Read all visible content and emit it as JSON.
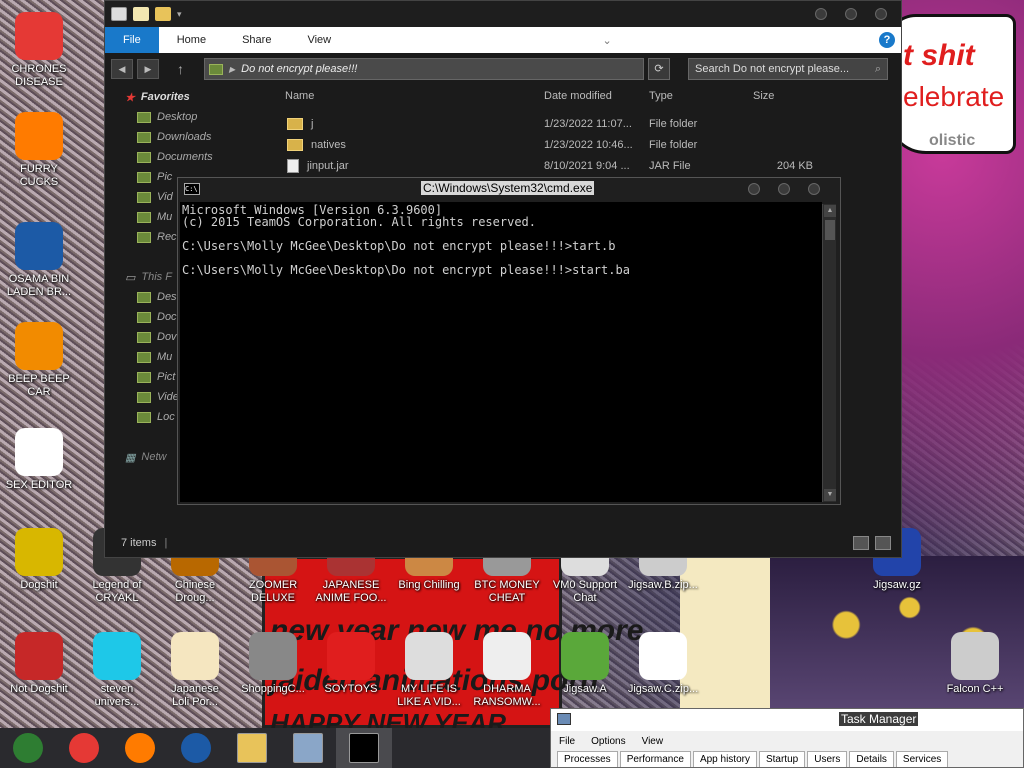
{
  "wallpaper": {
    "bubble_line1": "t shit",
    "bubble_line2": "elebrate",
    "bubble_line3": "olistic",
    "banner_line1": "new year new me no more",
    "banner_line2": "jaiden animations porn",
    "banner_line3": "HAPPY NEW YEAR"
  },
  "desktop_icons": [
    {
      "label": "CHRONES\nDISEASE",
      "icon": "chrome-icon",
      "color": "#e53935"
    },
    {
      "label": "FURRY CUCKS",
      "icon": "firefox-icon",
      "color": "#ff7b00"
    },
    {
      "label": "OSAMA BIN\nLADEN BR...",
      "icon": "obama-logo-icon",
      "color": "#1c5aa6"
    },
    {
      "label": "BEEP BEEP\nCAR",
      "icon": "vlc-cone-icon",
      "color": "#f28b00"
    },
    {
      "label": "SEX EDITOR",
      "icon": "hxd-icon",
      "color": "#ffffff"
    },
    {
      "label": "Dogshit",
      "icon": "dogshit-icon",
      "color": "#d8b700"
    },
    {
      "label": "Not Dogshit",
      "icon": "devcpp-icon",
      "color": "#c62828"
    },
    {
      "label": "steven\nunivers...",
      "icon": "diamond-icon",
      "color": "#1ec8e8"
    },
    {
      "label": "Japanese\nLoli Por...",
      "icon": "torii-icon",
      "color": "#f5e6c0"
    },
    {
      "label": "ShoppingC...",
      "icon": "flash-icon",
      "color": "#888888"
    },
    {
      "label": "SOYTOYS",
      "icon": "s-logo-icon",
      "color": "#e01e1e"
    },
    {
      "label": "MY LIFE IS\nLIKE A VID...",
      "icon": "gamepad-icon",
      "color": "#dddddd"
    },
    {
      "label": "DHARMA\nRANSOMW...",
      "icon": "skull-icon",
      "color": "#eeeeee"
    },
    {
      "label": "Jigsaw.A",
      "icon": "green-file-icon",
      "color": "#5aa83a"
    },
    {
      "label": "Jigsaw.C.zip...",
      "icon": "file-icon",
      "color": "#ffffff"
    },
    {
      "label": "Falcon C++",
      "icon": "trash-icon",
      "color": "#cccccc"
    },
    {
      "label": "Legend of\nCRYAKL",
      "icon": "legend-icon",
      "color": "#333333"
    },
    {
      "label": "Chinese\nDroug...",
      "icon": "chinese-icon",
      "color": "#b86800"
    },
    {
      "label": "ZOOMER\nDELUXE",
      "icon": "zoomer-icon",
      "color": "#aa5533"
    },
    {
      "label": "JAPANESE\nANIME FOO...",
      "icon": "anime-icon",
      "color": "#aa3333"
    },
    {
      "label": "Bing Chilling",
      "icon": "bing-icon",
      "color": "#cc8844"
    },
    {
      "label": "BTC MONEY\nCHEAT",
      "icon": "btc-icon",
      "color": "#999999"
    },
    {
      "label": "VM0 Support\nChat",
      "icon": "vm0-icon",
      "color": "#dddddd"
    },
    {
      "label": "Jigsaw.B.zip...",
      "icon": "zip-icon",
      "color": "#cccccc"
    },
    {
      "label": "Jigsaw.gz",
      "icon": "gz-icon",
      "color": "#2244aa"
    }
  ],
  "explorer": {
    "ribbon_tabs": [
      "File",
      "Home",
      "Share",
      "View"
    ],
    "address": "Do not encrypt please!!!",
    "search_placeholder": "Search Do not encrypt please...",
    "favorites_label": "Favorites",
    "sidebar_favorites": [
      "Desktop",
      "Downloads",
      "Documents",
      "Pic",
      "Vid",
      "Mu",
      "Rec"
    ],
    "this_pc_label": "This F",
    "sidebar_pc": [
      "Des",
      "Doc",
      "Dov",
      "Mu",
      "Pict",
      "Vide",
      "Loc"
    ],
    "network_label": "Netw",
    "columns": [
      "Name",
      "Date modified",
      "Type",
      "Size"
    ],
    "files": [
      {
        "name": "j",
        "date": "1/23/2022 11:07...",
        "type": "File folder",
        "size": "",
        "kind": "folder"
      },
      {
        "name": "natives",
        "date": "1/23/2022 10:46...",
        "type": "File folder",
        "size": "",
        "kind": "folder"
      },
      {
        "name": "jinput.jar",
        "date": "8/10/2021 9:04 ...",
        "type": "JAR File",
        "size": "204 KB",
        "kind": "file"
      }
    ],
    "status": "7 items"
  },
  "cmd": {
    "title": "C:\\Windows\\System32\\cmd.exe",
    "lines": "Microsoft Windows [Version 6.3.9600]\n(c) 2015 TeamOS Corporation. All rights reserved.\n\nC:\\Users\\Molly McGee\\Desktop\\Do not encrypt please!!!>tart.b\n\nC:\\Users\\Molly McGee\\Desktop\\Do not encrypt please!!!>start.ba"
  },
  "taskmgr": {
    "title": "Task Manager",
    "menu": [
      "File",
      "Options",
      "View"
    ],
    "tabs": [
      "Processes",
      "Performance",
      "App history",
      "Startup",
      "Users",
      "Details",
      "Services"
    ]
  },
  "taskbar": [
    {
      "icon": "chrome-colorful-icon",
      "color": "#2e7d32"
    },
    {
      "icon": "chrome-icon",
      "color": "#e53935"
    },
    {
      "icon": "firefox-icon",
      "color": "#ff7b00"
    },
    {
      "icon": "obama-logo-icon",
      "color": "#1c5aa6"
    },
    {
      "icon": "file-explorer-icon",
      "color": "#e8c35a"
    },
    {
      "icon": "task-manager-icon",
      "color": "#8aa6c8"
    },
    {
      "icon": "cmd-icon",
      "color": "#000000"
    }
  ]
}
